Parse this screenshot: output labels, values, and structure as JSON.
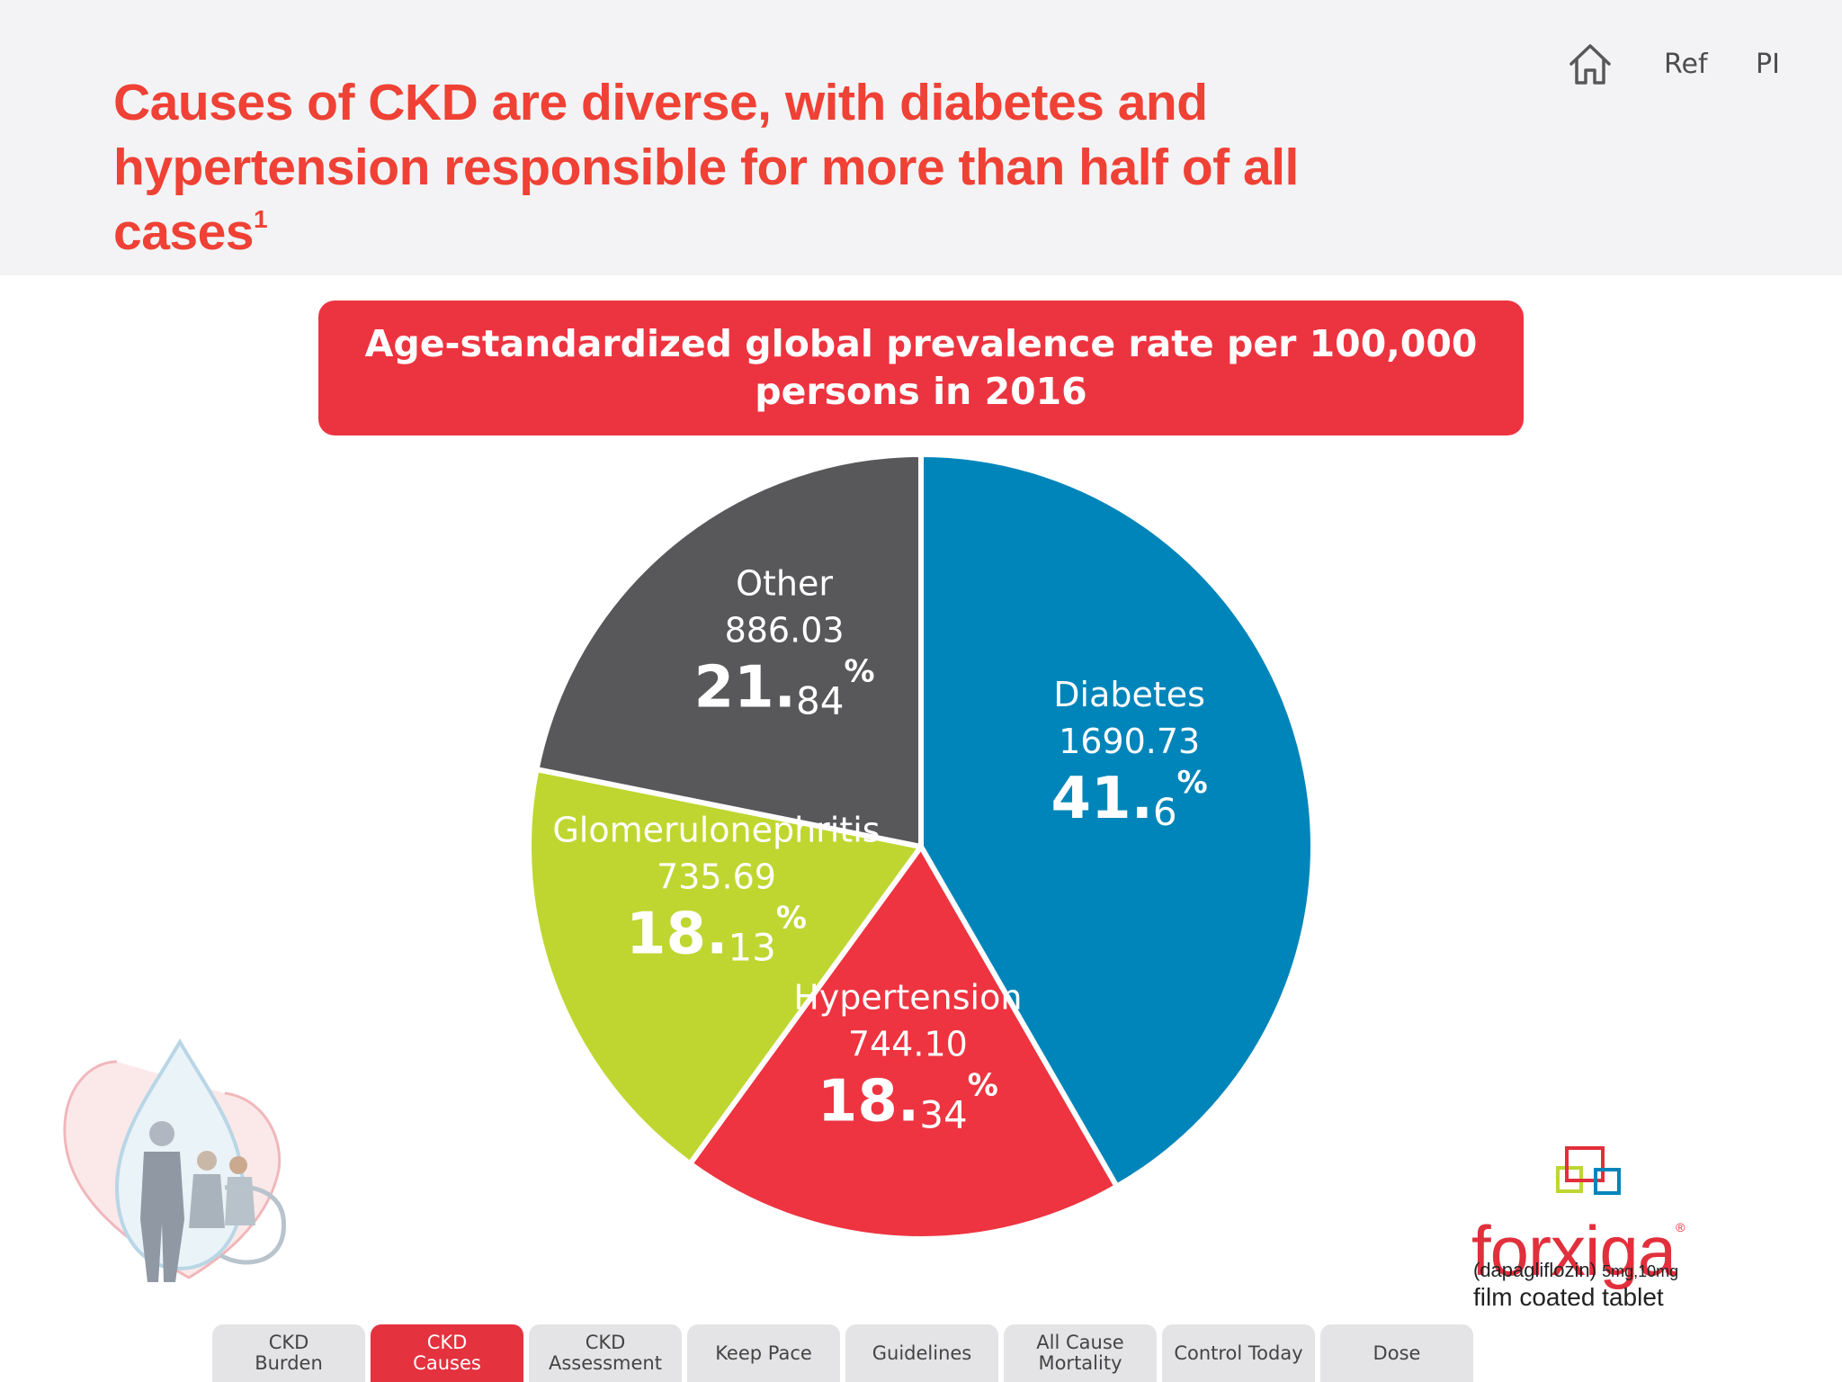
{
  "header": {
    "title_line1": "Causes of CKD are diverse, with diabetes and",
    "title_line2": "hypertension responsible for more than half of all cases",
    "title_ref": "1",
    "nav": {
      "home_icon": "home-icon",
      "ref_label": "Ref",
      "pi_label": "PI"
    }
  },
  "chart_data": {
    "type": "pie",
    "title": "Age-standardized global prevalence rate per 100,000 persons in 2016",
    "slices": [
      {
        "name": "Diabetes",
        "value": 1690.73,
        "value_label": "1690.73",
        "pct_int": "41",
        "pct_dec": "6",
        "percent": 41.6,
        "color": "#0085ba"
      },
      {
        "name": "Hypertension",
        "value": 744.1,
        "value_label": "744.10",
        "pct_int": "18",
        "pct_dec": "34",
        "percent": 18.34,
        "color": "#ed3440"
      },
      {
        "name": "Glomerulonephritis",
        "value": 735.69,
        "value_label": "735.69",
        "pct_int": "18",
        "pct_dec": "13",
        "percent": 18.13,
        "color": "#bfd630"
      },
      {
        "name": "Other",
        "value": 886.03,
        "value_label": "886.03",
        "pct_int": "21",
        "pct_dec": "84",
        "percent": 21.84,
        "color": "#58585b"
      }
    ],
    "percent_symbol": "%"
  },
  "logo": {
    "brand": "forxiga",
    "registered": "®",
    "generic": "(dapagliflozin)",
    "dose": "5mg,10mg",
    "form": "film coated tablet"
  },
  "bottom_nav": {
    "tabs": [
      {
        "label": "CKD\nBurden",
        "active": false
      },
      {
        "label": "CKD\nCauses",
        "active": true
      },
      {
        "label": "CKD\nAssessment",
        "active": false
      },
      {
        "label": "Keep Pace",
        "active": false
      },
      {
        "label": "Guidelines",
        "active": false
      },
      {
        "label": "All Cause\nMortality",
        "active": false
      },
      {
        "label": "Control Today",
        "active": false
      },
      {
        "label": "Dose",
        "active": false
      }
    ]
  }
}
